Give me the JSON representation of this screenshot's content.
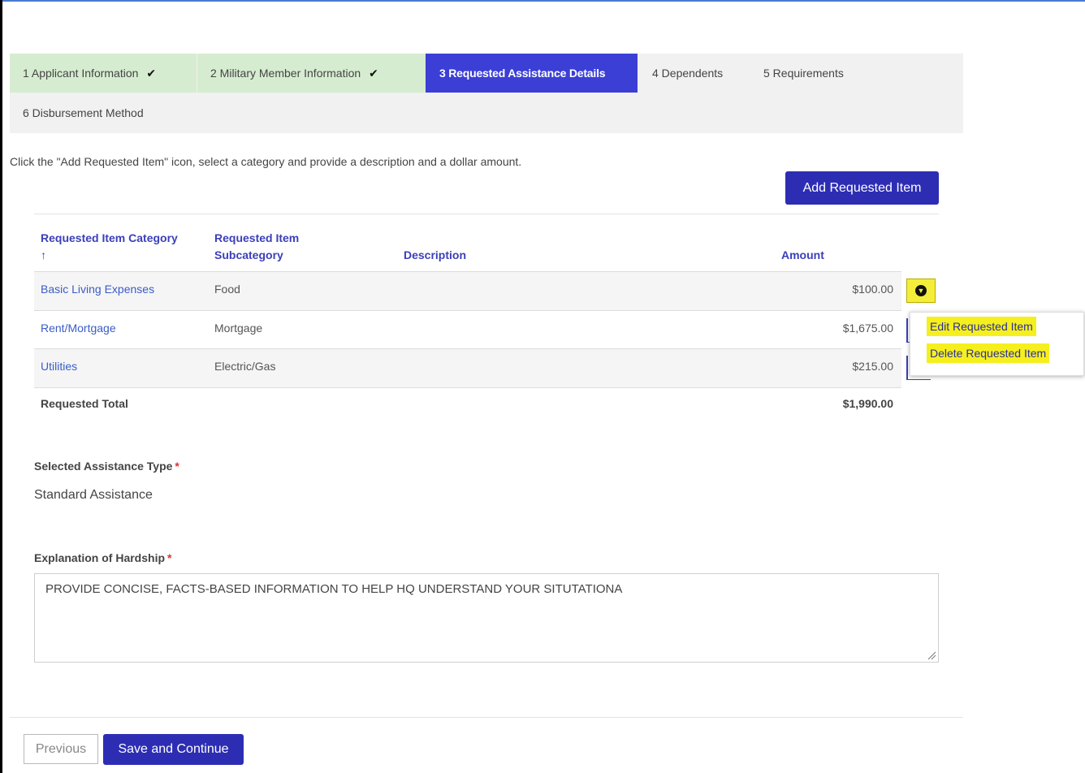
{
  "steps": [
    {
      "label": "1 Applicant Information",
      "state": "done"
    },
    {
      "label": "2 Military Member Information",
      "state": "done"
    },
    {
      "label": "3 Requested Assistance Details",
      "state": "active"
    },
    {
      "label": "4 Dependents",
      "state": "pending"
    },
    {
      "label": "5 Requirements",
      "state": "pending"
    },
    {
      "label": "6 Disbursement Method",
      "state": "pending"
    }
  ],
  "check_glyph": "✔",
  "instructions": "Click the \"Add Requested Item\" icon, select a category and provide a description and a dollar amount.",
  "add_button_label": "Add Requested Item",
  "table": {
    "headers": {
      "category": "Requested Item Category",
      "sort_arrow": "↑",
      "subcategory_line1": "Requested Item",
      "subcategory_line2": "Subcategory",
      "description": "Description",
      "amount": "Amount"
    },
    "rows": [
      {
        "category": "Basic Living Expenses",
        "subcategory": "Food",
        "description": "",
        "amount": "$100.00"
      },
      {
        "category": "Rent/Mortgage",
        "subcategory": "Mortgage",
        "description": "",
        "amount": "$1,675.00"
      },
      {
        "category": "Utilities",
        "subcategory": "Electric/Gas",
        "description": "",
        "amount": "$215.00"
      }
    ],
    "total_label": "Requested Total",
    "total_value": "$1,990.00"
  },
  "row_menu": {
    "icon": "chevron-down-circle-icon",
    "items": [
      "Edit Requested Item",
      "Delete Requested Item"
    ]
  },
  "assistance_type": {
    "label": "Selected Assistance Type",
    "required_mark": "*",
    "value": "Standard Assistance"
  },
  "hardship": {
    "label": "Explanation of Hardship",
    "required_mark": "*",
    "value": "PROVIDE CONCISE, FACTS-BASED INFORMATION TO HELP HQ UNDERSTAND YOUR SITUTATIONA"
  },
  "footer": {
    "previous_label": "Previous",
    "save_label": "Save and Continue"
  },
  "colors": {
    "active_step": "#3b3fd6",
    "done_step": "#d6ecd0",
    "primary_button": "#2d2db4",
    "highlight": "#f6ef1e"
  }
}
